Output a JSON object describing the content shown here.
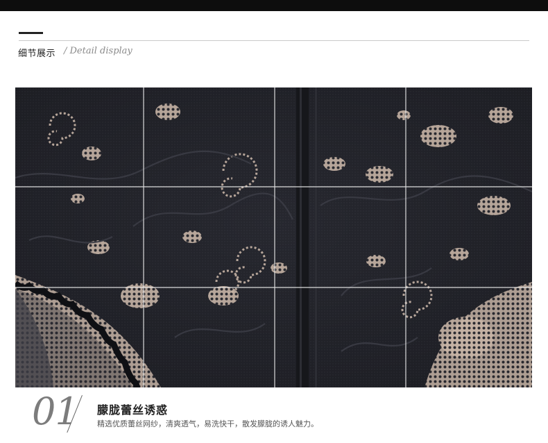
{
  "header": {
    "title_cn": "细节展示",
    "title_en": "/ Detail display"
  },
  "photo": {
    "icon": "lace-detail-photo",
    "colors": {
      "lace": "#1b1c22",
      "skin": "#c9b8aa",
      "grid": "#e6e6e6"
    }
  },
  "caption": {
    "number": "01",
    "title": "朦胧蕾丝诱惑",
    "description": "精选优质蕾丝网纱，清爽透气，易洗快干，散发朦胧的诱人魅力。"
  }
}
